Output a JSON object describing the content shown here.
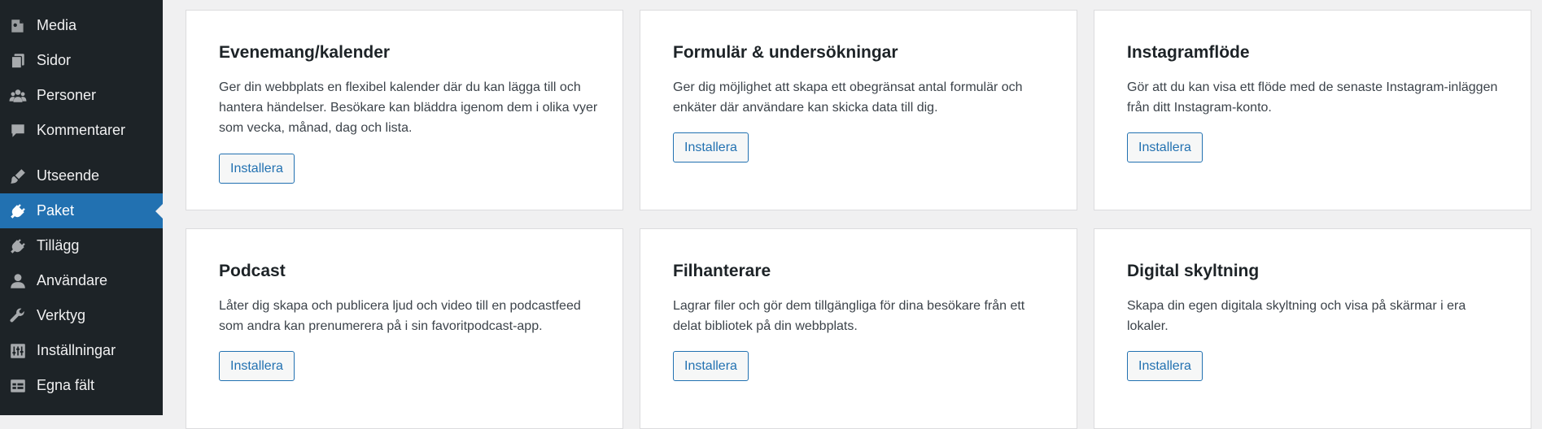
{
  "sidebar": {
    "items": [
      {
        "label": "Media",
        "icon": "media-icon"
      },
      {
        "label": "Sidor",
        "icon": "pages-icon"
      },
      {
        "label": "Personer",
        "icon": "people-icon"
      },
      {
        "label": "Kommentarer",
        "icon": "comments-icon"
      },
      {
        "label": "Utseende",
        "icon": "appearance-brush-icon"
      },
      {
        "label": "Paket",
        "icon": "plugin-plug-icon",
        "active": true
      },
      {
        "label": "Tillägg",
        "icon": "plugin-plug-icon"
      },
      {
        "label": "Användare",
        "icon": "user-icon"
      },
      {
        "label": "Verktyg",
        "icon": "wrench-icon"
      },
      {
        "label": "Inställningar",
        "icon": "settings-sliders-icon"
      },
      {
        "label": "Egna fält",
        "icon": "table-grid-icon"
      }
    ],
    "colors": {
      "background": "#1d2327",
      "active": "#2271b1",
      "text": "#f0f0f1",
      "icon": "#a7aaad"
    }
  },
  "cards": [
    {
      "title": "Evenemang/kalender",
      "description": "Ger din webbplats en flexibel kalender där du kan lägga till och hantera händelser. Besökare kan bläddra igenom dem i olika vyer som vecka, månad, dag och lista.",
      "button": "Installera"
    },
    {
      "title": "Formulär & undersökningar",
      "description": "Ger dig möjlighet att skapa ett obegränsat antal formulär och enkäter där användare kan skicka data till dig.",
      "button": "Installera"
    },
    {
      "title": "Instagramflöde",
      "description": "Gör att du kan visa ett flöde med de senaste Instagram-inläggen från ditt Instagram-konto.",
      "button": "Installera"
    },
    {
      "title": "Podcast",
      "description": "Låter dig skapa och publicera ljud och video till en podcastfeed som andra kan prenumerera på i sin favoritpodcast-app.",
      "button": "Installera"
    },
    {
      "title": "Filhanterare",
      "description": "Lagrar filer och gör dem tillgängliga för dina besökare från ett delat bibliotek på din webbplats.",
      "button": "Installera"
    },
    {
      "title": "Digital skyltning",
      "description": "Skapa din egen digitala skyltning och visa på skärmar i era lokaler.",
      "button": "Installera"
    }
  ],
  "colors": {
    "page_background": "#f0f0f1",
    "card_background": "#ffffff",
    "button_accent": "#2271b1"
  }
}
